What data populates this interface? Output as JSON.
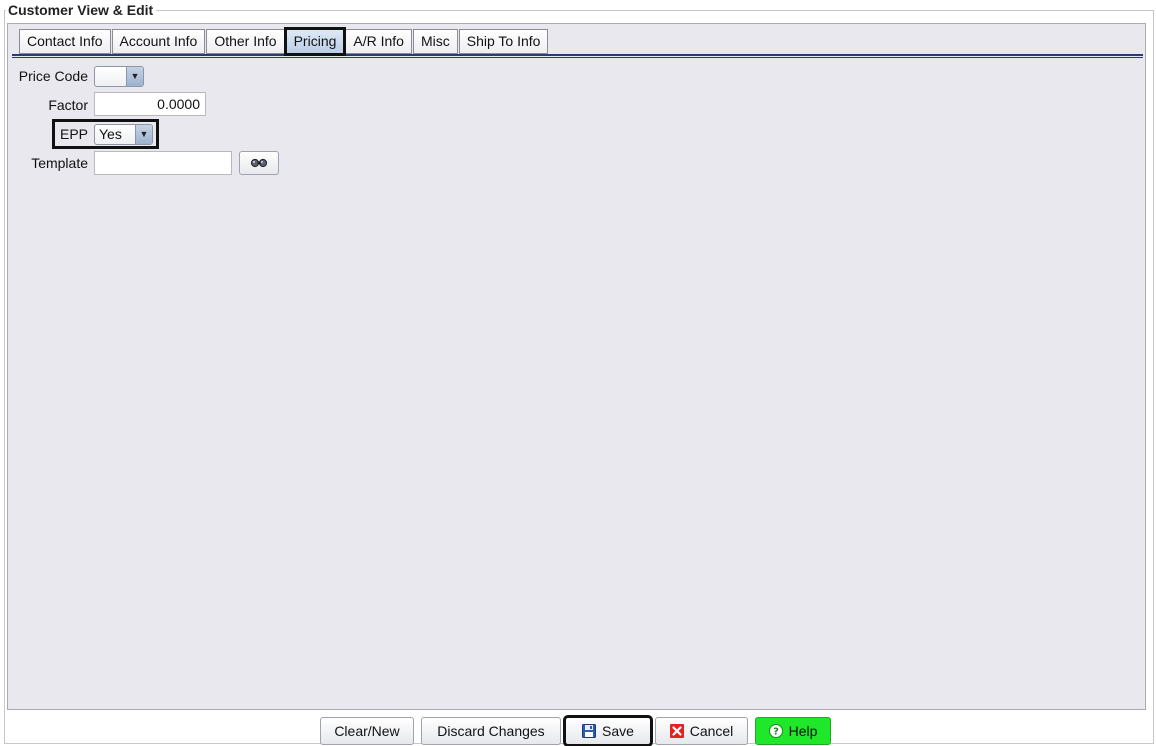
{
  "window": {
    "title": "Customer View & Edit"
  },
  "tabs": [
    {
      "label": "Contact Info",
      "active": false
    },
    {
      "label": "Account Info",
      "active": false
    },
    {
      "label": "Other Info",
      "active": false
    },
    {
      "label": "Pricing",
      "active": true
    },
    {
      "label": "A/R Info",
      "active": false
    },
    {
      "label": "Misc",
      "active": false
    },
    {
      "label": "Ship To Info",
      "active": false
    }
  ],
  "form": {
    "price_code": {
      "label": "Price Code",
      "value": ""
    },
    "factor": {
      "label": "Factor",
      "value": "0.0000"
    },
    "epp": {
      "label": "EPP",
      "value": "Yes"
    },
    "template": {
      "label": "Template",
      "value": "",
      "lookup_icon": "binoculars-icon"
    }
  },
  "buttons": {
    "clear_new": "Clear/New",
    "discard": "Discard Changes",
    "save": "Save",
    "cancel": "Cancel",
    "help": "Help"
  },
  "colors": {
    "help_button": "#1fe82a",
    "cancel_icon": "#e02424",
    "save_icon": "#2a5db0",
    "tab_rule": "#2b3a7a",
    "panel_bg": "#e8e8ee"
  }
}
